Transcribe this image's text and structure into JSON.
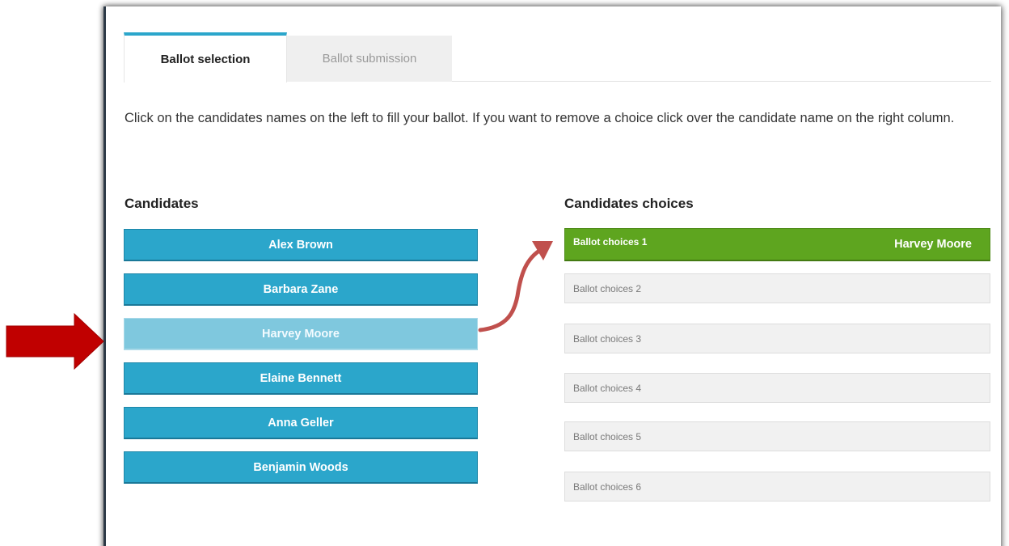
{
  "tabs": [
    {
      "label": "Ballot selection",
      "active": true
    },
    {
      "label": "Ballot submission",
      "active": false
    }
  ],
  "instructions": "Click on the candidates names on the left to fill your ballot. If you want to remove a choice click over the candidate name on the right column.",
  "candidates": {
    "title": "Candidates",
    "items": [
      {
        "name": "Alex Brown",
        "selected": false
      },
      {
        "name": "Barbara Zane",
        "selected": false
      },
      {
        "name": "Harvey Moore",
        "selected": true
      },
      {
        "name": "Elaine Bennett",
        "selected": false
      },
      {
        "name": "Anna Geller",
        "selected": false
      },
      {
        "name": "Benjamin Woods",
        "selected": false
      }
    ]
  },
  "choices": {
    "title": "Candidates choices",
    "slots": [
      {
        "label": "Ballot choices 1",
        "candidate": "Harvey Moore"
      },
      {
        "label": "Ballot choices 2",
        "candidate": ""
      },
      {
        "label": "Ballot choices 3",
        "candidate": ""
      },
      {
        "label": "Ballot choices 4",
        "candidate": ""
      },
      {
        "label": "Ballot choices 5",
        "candidate": ""
      },
      {
        "label": "Ballot choices 6",
        "candidate": ""
      }
    ]
  },
  "colors": {
    "candidate_button": "#2ba6cb",
    "candidate_selected": "#7fc8de",
    "choice_filled": "#5ea51f",
    "choice_empty": "#f1f1f1",
    "pointer_arrow": "#c00000",
    "curve_arrow": "#c0504d"
  },
  "icons": {
    "pointer": "right-arrow-icon",
    "transfer": "curved-arrow-icon"
  }
}
